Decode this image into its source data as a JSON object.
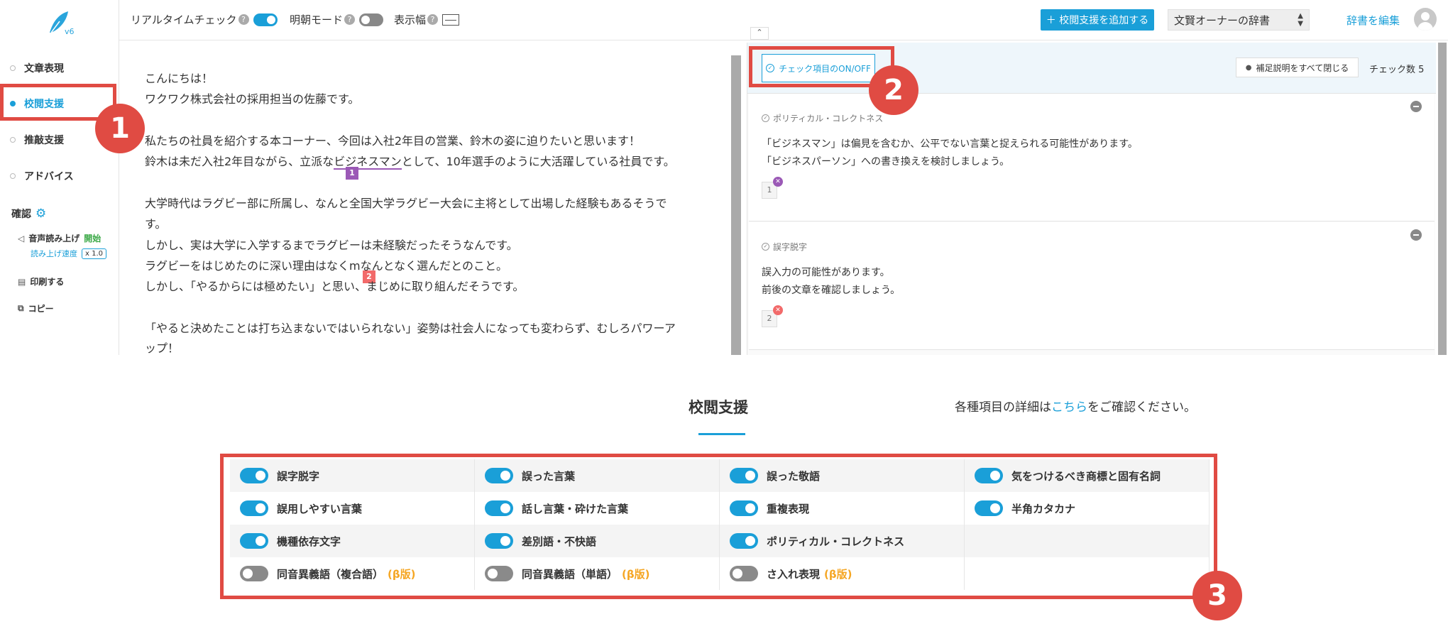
{
  "app": {
    "version": "v6"
  },
  "sidebar": {
    "items": [
      {
        "label": "文章表現",
        "active": false
      },
      {
        "label": "校閲支援",
        "active": true
      },
      {
        "label": "推敲支援",
        "active": false
      },
      {
        "label": "アドバイス",
        "active": false
      }
    ],
    "confirm_label": "確認",
    "read_aloud_label": "音声読み上げ",
    "read_aloud_start": "開始",
    "read_speed_label": "読み上げ速度",
    "read_speed_value": "x 1.0",
    "print_label": "印刷する",
    "copy_label": "コピー"
  },
  "toolbar": {
    "realtime_check_label": "リアルタイムチェック",
    "realtime_check_on": true,
    "mincho_mode_label": "明朝モード",
    "mincho_mode_on": false,
    "display_width_label": "表示幅",
    "add_proofread_button": "＋ 校閲支援を追加する",
    "dictionary_selected": "文賢オーナーの辞書",
    "edit_dictionary_link": "辞書を編集"
  },
  "editor": {
    "lines": [
      "こんにちは！",
      "ワクワク株式会社の採用担当の佐藤です。",
      "",
      "私たちの社員を紹介する本コーナー、今回は入社2年目の営業、鈴木の姿に迫りたいと思います！",
      "大学時代はラグビー部に所属し、なんと全国大学ラグビー大会に主将として出場した経験もあるそうで",
      "す。",
      "しかし、実は大学に入学するまでラグビーは未経験だったそうなんです。",
      "ラグビーをはじめたのに深い理由はなくmなんとなく選んだとのこと。",
      "しかし、「やるからには極めたい」と思い、まじめに取り組んだそうです。",
      "",
      "「やると決めたことは打ち込まないではいられない」姿勢は社会人になっても変わらず、むしろパワーア",
      "ップ！"
    ],
    "flagged_line": {
      "before": "鈴木は未だ入社2年目ながら、立派な",
      "flagged": "ビジネスマン",
      "after": "として、10年選手のように大活躍している社員です。"
    },
    "marker_1": "1",
    "marker_2": "2"
  },
  "results": {
    "onoff_button": "チェック項目のON/OFF",
    "close_all_button": "補足説明をすべて閉じる",
    "check_count_label": "チェック数",
    "check_count": "5",
    "cards": [
      {
        "category": "ポリティカル・コレクトネス",
        "lines": [
          "「ビジネスマン」は偏見を含むか、公平でない言葉と捉えられる可能性があります。",
          "「ビジネスパーソン」への書き換えを検討しましょう。"
        ],
        "number": "1"
      },
      {
        "category": "誤字脱字",
        "lines": [
          "誤入力の可能性があります。",
          "前後の文章を確認しましょう。"
        ],
        "number": "2"
      }
    ]
  },
  "settings": {
    "title": "校閲支援",
    "note_prefix": "各種項目の詳細は",
    "note_link": "こちら",
    "note_suffix": "をご確認ください。",
    "options": [
      [
        {
          "label": "誤字脱字",
          "on": true,
          "beta": ""
        },
        {
          "label": "誤った言葉",
          "on": true,
          "beta": ""
        },
        {
          "label": "誤った敬語",
          "on": true,
          "beta": ""
        },
        {
          "label": "気をつけるべき商標と固有名詞",
          "on": true,
          "beta": ""
        }
      ],
      [
        {
          "label": "誤用しやすい言葉",
          "on": true,
          "beta": ""
        },
        {
          "label": "話し言葉・砕けた言葉",
          "on": true,
          "beta": ""
        },
        {
          "label": "重複表現",
          "on": true,
          "beta": ""
        },
        {
          "label": "半角カタカナ",
          "on": true,
          "beta": ""
        }
      ],
      [
        {
          "label": "機種依存文字",
          "on": true,
          "beta": ""
        },
        {
          "label": "差別語・不快語",
          "on": true,
          "beta": ""
        },
        {
          "label": "ポリティカル・コレクトネス",
          "on": true,
          "beta": ""
        },
        null
      ],
      [
        {
          "label": "同音異義語（複合語）",
          "on": false,
          "beta": "(β版)"
        },
        {
          "label": "同音異義語（単語）",
          "on": false,
          "beta": "(β版)"
        },
        {
          "label": "さ入れ表現",
          "on": false,
          "beta": "(β版)"
        },
        null
      ]
    ]
  },
  "annotations": [
    "1",
    "2",
    "3"
  ],
  "colors": {
    "accent": "#1a9fd8",
    "annotation_red": "#e04b43",
    "flag_purple": "#9b59b6",
    "flag_red": "#f26a6a",
    "beta_orange": "#f5a623"
  }
}
